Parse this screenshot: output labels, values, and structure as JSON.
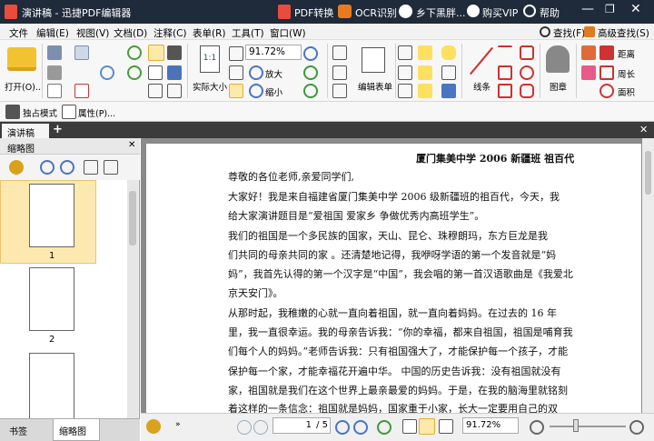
{
  "titlebar": {
    "app_title": "演讲稿 - 迅捷PDF编辑器",
    "pdf_convert": "PDF转换",
    "ocr": "OCR识别",
    "user": "乡下黑胖...",
    "vip": "购买VIP",
    "help": "帮助"
  },
  "menu": {
    "items": [
      "文件",
      "编辑(E)",
      "视图(V)",
      "文档(D)",
      "注释(C)",
      "表单(R)",
      "工具(T)",
      "窗口(W)"
    ],
    "find": "查找(F)",
    "advanced_find": "高级查找(S)"
  },
  "ribbon": {
    "open": "打开(O)...",
    "zoom_value": "91.72%",
    "actual_size": "实际大小",
    "zoom_in": "放大",
    "zoom_out": "缩小",
    "edit_form": "编辑表单",
    "lines": "线条",
    "stamp": "图章",
    "perimeter": "周长",
    "area": "面积",
    "distance": "距离",
    "solo_mode": "独占模式",
    "properties": "属性(P)..."
  },
  "tab": {
    "doc_name": "演讲稿"
  },
  "sidebar": {
    "title": "缩略图",
    "pages": [
      "1",
      "2"
    ],
    "tab_bookmarks": "书签",
    "tab_thumbs": "缩略图"
  },
  "document": {
    "header": "厦门集美中学 2006 新疆班   祖百代",
    "lines": [
      "尊敬的各位老师,亲爱同学们,",
      "    大家好！我是来自福建省厦门集美中学 2006 级新疆班的祖百代，今天，我",
      "给大家演讲题目是“爱祖国  爱家乡  争做优秀内高班学生”。",
      "    我们的祖国是一个多民族的国家，天山、昆仑、珠穆朗玛，东方巨龙是我",
      "们共同的母亲共同的家  。还清楚地记得，我咿呀学语的第一个发音就是“妈",
      "妈”，我首先认得的第一个汉字是“中国”，我会唱的第一首汉语歌曲是《我爱北",
      "京天安门》。",
      "    从那时起，我稚嫩的心就一直向着祖国，就一直向着妈妈。在过去的 16 年",
      "里，我一直很幸运。我的母亲告诉我：“你的幸福，都来自祖国，祖国是哺育我",
      "们每个人的妈妈。”老师告诉我：只有祖国强大了，才能保护每一个孩子，才能",
      "保护每一个家，才能幸福花开遍中华。  中国的历史告诉我：没有祖国就没有",
      "家，祖国就是我们在这个世界上最亲最爱的妈妈。于是，在我的脑海里就铭刻",
      "着这样的一条信念：祖国就是妈妈，国家重于小家，长大一定要用自己的双"
    ]
  },
  "status": {
    "page_current": "1",
    "page_total": "/ 5",
    "zoom": "91.72%"
  }
}
